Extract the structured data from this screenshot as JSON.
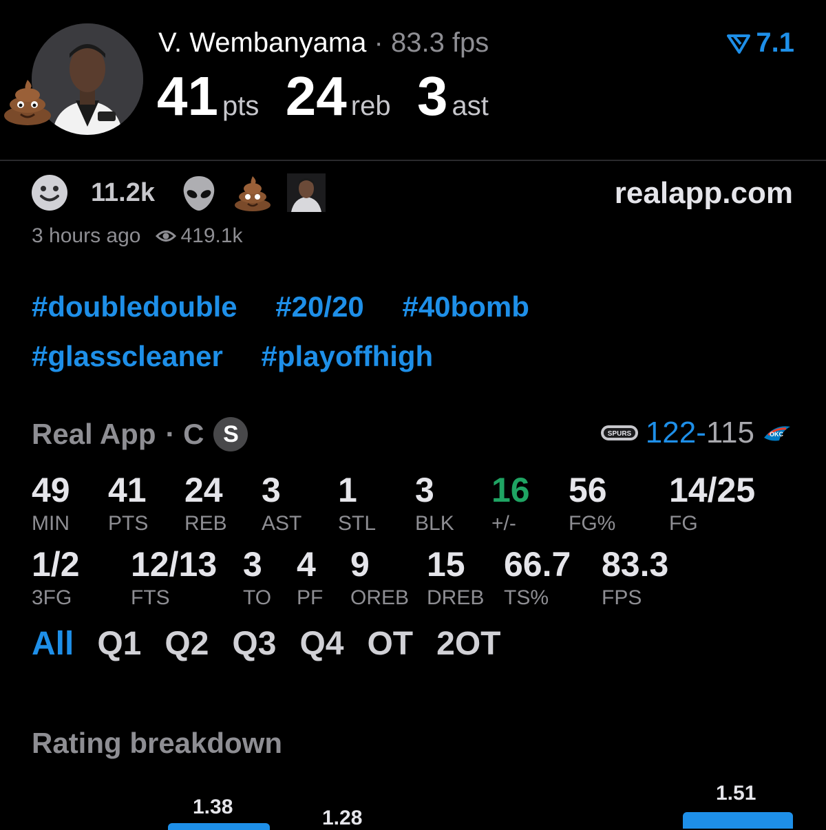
{
  "player": {
    "name": "V. Wembanyama",
    "separator": "·",
    "fps_text": "83.3 fps",
    "pts": "41",
    "pts_unit": "pts",
    "reb": "24",
    "reb_unit": "reb",
    "ast": "3",
    "ast_unit": "ast",
    "rating": "7.1",
    "avatar_icon": "player-headshot",
    "badge_icon": "poop-emoji"
  },
  "reactions": {
    "smile_count": "11.2k",
    "icons": [
      "smile-emoji",
      "alien-emoji",
      "poop-emoji",
      "user-avatar"
    ]
  },
  "brand": "realapp.com",
  "meta": {
    "time": "3 hours ago",
    "views": "419.1k"
  },
  "hashtags": {
    "row1": [
      "#doubledouble",
      "#20/20",
      "#40bomb"
    ],
    "row2": [
      "#glasscleaner",
      "#playoffhigh"
    ]
  },
  "game": {
    "source": "Real App",
    "position": "· C",
    "badge": "S",
    "team_score": "122",
    "dash": "-",
    "opp_score": "115",
    "team_logo": "spurs-logo",
    "opp_logo": "okc-logo"
  },
  "stats_row1": [
    {
      "value": "49",
      "label": "MIN"
    },
    {
      "value": "41",
      "label": "PTS"
    },
    {
      "value": "24",
      "label": "REB"
    },
    {
      "value": "3",
      "label": "AST"
    },
    {
      "value": "1",
      "label": "STL"
    },
    {
      "value": "3",
      "label": "BLK"
    },
    {
      "value": "16",
      "label": "+/-"
    },
    {
      "value": "56",
      "label": "FG%"
    },
    {
      "value": "14/25",
      "label": "FG"
    }
  ],
  "stats_row2": [
    {
      "value": "1/2",
      "label": "3FG"
    },
    {
      "value": "12/13",
      "label": "FTS"
    },
    {
      "value": "3",
      "label": "TO"
    },
    {
      "value": "4",
      "label": "PF"
    },
    {
      "value": "9",
      "label": "OREB"
    },
    {
      "value": "15",
      "label": "DREB"
    },
    {
      "value": "66.7",
      "label": "TS%"
    },
    {
      "value": "83.3",
      "label": "FPS"
    }
  ],
  "period_tabs": [
    "All",
    "Q1",
    "Q2",
    "Q3",
    "Q4",
    "OT",
    "2OT"
  ],
  "rating_breakdown": {
    "title": "Rating breakdown",
    "values": [
      "1.38",
      "1.28",
      "1.51"
    ]
  },
  "colors": {
    "accent": "#1e8fe8",
    "positive": "#1fa463",
    "background": "#000000"
  }
}
